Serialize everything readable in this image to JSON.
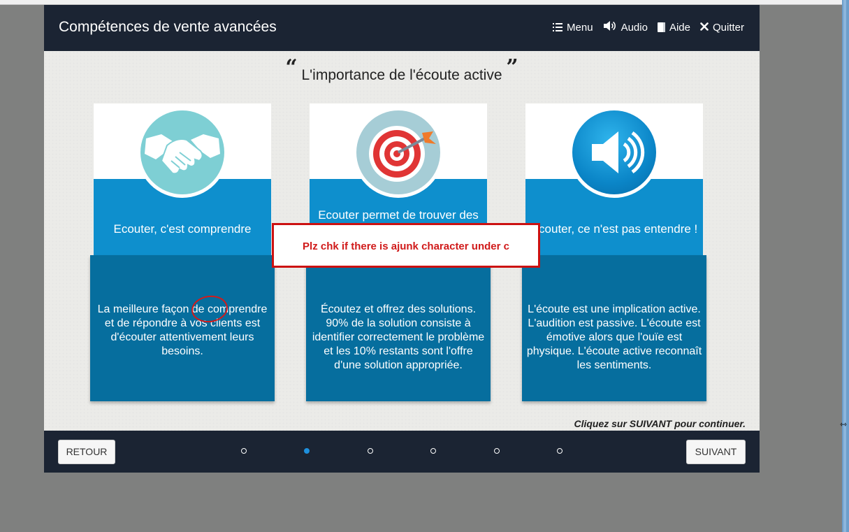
{
  "header": {
    "course_title": "Compétences de vente avancées",
    "nav": [
      {
        "label": "Menu",
        "icon": "list-icon"
      },
      {
        "label": "Audio",
        "icon": "speaker-icon"
      },
      {
        "label": "Aide",
        "icon": "book-icon"
      },
      {
        "label": "Quitter",
        "icon": "close-icon"
      }
    ]
  },
  "slide": {
    "title": "L'importance de l'écoute active",
    "open_quote": "“",
    "close_quote": "”",
    "cards": [
      {
        "icon": "handshake-icon",
        "heading": "Ecouter, c'est comprendre",
        "body": "La meilleure façon de comprendre et de répondre à vos clients est d'écouter attentivement leurs besoins."
      },
      {
        "icon": "target-icon",
        "heading": "Ecouter permet de trouver des",
        "body": "Écoutez et offrez des solutions. 90% de la solution consiste à identifier correctement le problème et les 10% restants sont l'offre d'une solution appropriée."
      },
      {
        "icon": "speaker-icon",
        "heading": "Ecouter, ce n'est pas entendre !",
        "body": "L'écoute est une implication active. L'audition est passive. L'écoute est émotive alors que l'ouïe est physique. L'écoute active reconnaît les sentiments."
      }
    ],
    "continue_text": "Cliquez sur SUIVANT pour continuer."
  },
  "footer": {
    "back_label": "RETOUR",
    "next_label": "SUIVANT",
    "progress": {
      "total": 6,
      "current": 2
    }
  },
  "annotation": {
    "text": "Plz chk if there is ajunk character under c",
    "color": "#d01a1a"
  },
  "colors": {
    "header_bg": "#1b2433",
    "card_blue": "#0e8fcd",
    "card_dark": "#066e9e",
    "active_dot": "#1e90dd"
  }
}
